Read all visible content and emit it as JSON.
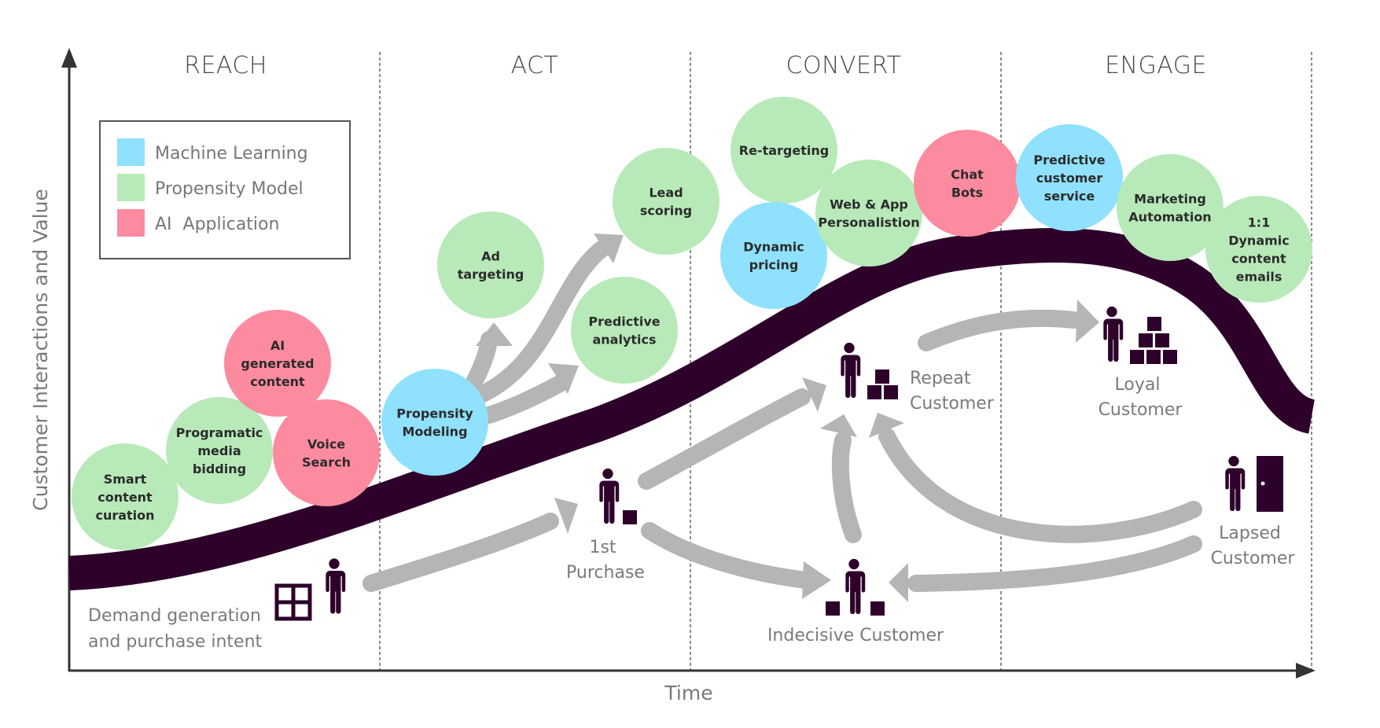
{
  "colors": {
    "machine_learning": "#8fe1fd",
    "propensity_model": "#b8eab9",
    "ai_application": "#fd8ba0",
    "curve": "#2e012b",
    "arrow": "#b5b5b5",
    "icon": "#2e012b",
    "axis": "#333333",
    "text": "#7a7a7a"
  },
  "sections": [
    "REACH",
    "ACT",
    "CONVERT",
    "ENGAGE"
  ],
  "axes": {
    "x_label": "Time",
    "y_label": "Customer Interactions and Value"
  },
  "legend": [
    {
      "label": "Machine Learning",
      "category": "machine_learning"
    },
    {
      "label": "Propensity Model",
      "category": "propensity_model"
    },
    {
      "label": "AI  Application",
      "category": "ai_application"
    }
  ],
  "bubbles": [
    {
      "id": "smart-content-curation",
      "lines": [
        "Smart",
        "content",
        "curation"
      ],
      "category": "propensity_model",
      "section": "REACH"
    },
    {
      "id": "programatic-media-bidding",
      "lines": [
        "Programatic",
        "media",
        "bidding"
      ],
      "category": "propensity_model",
      "section": "REACH"
    },
    {
      "id": "ai-generated-content",
      "lines": [
        "AI",
        "generated",
        "content"
      ],
      "category": "ai_application",
      "section": "REACH"
    },
    {
      "id": "voice-search",
      "lines": [
        "Voice",
        "Search"
      ],
      "category": "ai_application",
      "section": "REACH"
    },
    {
      "id": "propensity-modeling",
      "lines": [
        "Propensity",
        "Modeling"
      ],
      "category": "machine_learning",
      "section": "ACT"
    },
    {
      "id": "ad-targeting",
      "lines": [
        "Ad",
        "targeting"
      ],
      "category": "propensity_model",
      "section": "ACT"
    },
    {
      "id": "lead-scoring",
      "lines": [
        "Lead",
        "scoring"
      ],
      "category": "propensity_model",
      "section": "ACT"
    },
    {
      "id": "predictive-analytics",
      "lines": [
        "Predictive",
        "analytics"
      ],
      "category": "propensity_model",
      "section": "ACT"
    },
    {
      "id": "re-targeting",
      "lines": [
        "Re-targeting"
      ],
      "category": "propensity_model",
      "section": "CONVERT"
    },
    {
      "id": "dynamic-pricing",
      "lines": [
        "Dynamic",
        "pricing"
      ],
      "category": "machine_learning",
      "section": "CONVERT"
    },
    {
      "id": "web-app-personalisation",
      "lines": [
        "Web & App",
        "Personalistion"
      ],
      "category": "propensity_model",
      "section": "CONVERT"
    },
    {
      "id": "chat-bots",
      "lines": [
        "Chat",
        "Bots"
      ],
      "category": "ai_application",
      "section": "CONVERT"
    },
    {
      "id": "predictive-customer-service",
      "lines": [
        "Predictive",
        "customer",
        "service"
      ],
      "category": "machine_learning",
      "section": "ENGAGE"
    },
    {
      "id": "marketing-automation",
      "lines": [
        "Marketing",
        "Automation"
      ],
      "category": "propensity_model",
      "section": "ENGAGE"
    },
    {
      "id": "dynamic-content-emails",
      "lines": [
        "1:1",
        "Dynamic",
        "content",
        "emails"
      ],
      "category": "propensity_model",
      "section": "ENGAGE"
    }
  ],
  "stages": [
    {
      "id": "demand-generation",
      "lines": [
        "Demand generation",
        "and purchase intent"
      ],
      "icon": "window-icon"
    },
    {
      "id": "first-purchase",
      "lines": [
        "1st",
        "Purchase"
      ],
      "icon": "box-icon"
    },
    {
      "id": "repeat-customer",
      "lines": [
        "Repeat",
        "Customer"
      ],
      "icon": "boxes-stack-icon"
    },
    {
      "id": "indecisive-customer",
      "lines": [
        "Indecisive Customer"
      ],
      "icon": "boxes-apart-icon"
    },
    {
      "id": "loyal-customer",
      "lines": [
        "Loyal",
        "Customer"
      ],
      "icon": "boxes-pyramid-icon"
    },
    {
      "id": "lapsed-customer",
      "lines": [
        "Lapsed",
        "Customer"
      ],
      "icon": "door-icon"
    }
  ]
}
